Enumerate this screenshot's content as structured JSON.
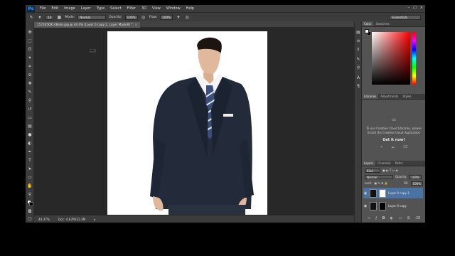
{
  "app": {
    "logo": "Ps"
  },
  "menu": [
    "File",
    "Edit",
    "Image",
    "Layer",
    "Type",
    "Select",
    "Filter",
    "3D",
    "View",
    "Window",
    "Help"
  ],
  "window_controls": [
    "–",
    "□",
    "×"
  ],
  "options_bar": {
    "brush_size": "13",
    "mode_label": "Mode:",
    "mode_value": "Normal",
    "opacity_label": "Opacity:",
    "opacity_value": "100%",
    "flow_label": "Flow:",
    "flow_value": "100%",
    "workspace": "Essentials"
  },
  "document_tab": {
    "title": "15726509148edo.jpg @ 44.4% (Layer 0 copy 2, Layer Mask/8) *",
    "close": "×"
  },
  "status_bar": {
    "zoom": "44.37%",
    "doc": "Doc: 4.67M/31.3M"
  },
  "color_panel": {
    "tabs": [
      "Color",
      "Swatches"
    ],
    "foreground": "#ffffff",
    "background": "#000000",
    "hue_color": "#ff0000"
  },
  "libraries_panel": {
    "tabs": [
      "Libraries",
      "Adjustments",
      "Styles"
    ],
    "message": "To use Creative Cloud Libraries, please install the Creative Cloud Application",
    "link": "Get it now!"
  },
  "layers_panel": {
    "tabs": [
      "Layers",
      "Channels",
      "Paths"
    ],
    "kind": "Kind",
    "blend_mode": "Normal",
    "opacity_label": "Opacity:",
    "opacity_value": "100%",
    "lock_label": "Lock:",
    "fill_label": "Fill:",
    "fill_value": "100%",
    "layers": [
      {
        "name": "Layer 0 copy 2",
        "selected": true
      },
      {
        "name": "Layer 0 copy",
        "selected": false
      }
    ]
  }
}
